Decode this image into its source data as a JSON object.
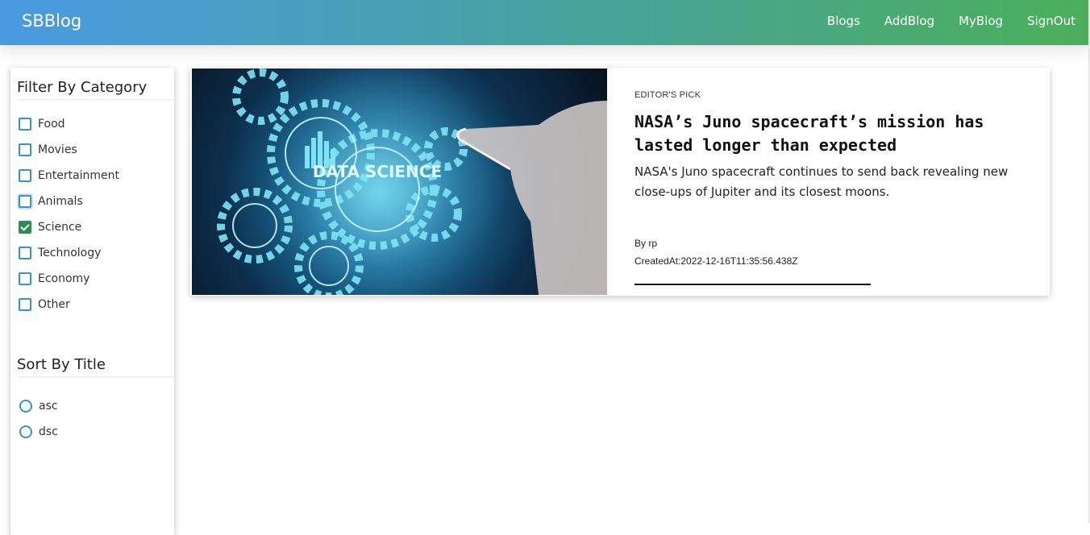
{
  "navbar": {
    "brand": "SBBlog",
    "links": [
      "Blogs",
      "AddBlog",
      "MyBlog",
      "SignOut"
    ]
  },
  "sidebar": {
    "filter_title": "Filter By Category",
    "categories": [
      {
        "label": "Food",
        "checked": false
      },
      {
        "label": "Movies",
        "checked": false
      },
      {
        "label": "Entertainment",
        "checked": false
      },
      {
        "label": "Animals",
        "checked": false
      },
      {
        "label": "Science",
        "checked": true
      },
      {
        "label": "Technology",
        "checked": false
      },
      {
        "label": "Economy",
        "checked": false
      },
      {
        "label": "Other",
        "checked": false
      }
    ],
    "sort_title": "Sort By Title",
    "sort_options": [
      "asc",
      "dsc"
    ]
  },
  "card": {
    "image_text": "DATA SCIENCE",
    "pick": "EDITOR'S PICK",
    "title": "NASA’s Juno spacecraft’s mission has lasted longer than expected",
    "summary": "NASA's Juno spacecraft continues to send back revealing new close-ups of Jupiter and its closest moons.",
    "author": "By rp",
    "created": "CreatedAt:2022-12-16T11:35:56.438Z"
  },
  "colors": {
    "nav_gradient_start": "#4a9ae2",
    "nav_gradient_end": "#4caf5a",
    "checkbox_border": "#3a8fd6",
    "checkbox_checked": "#2e8b57"
  }
}
